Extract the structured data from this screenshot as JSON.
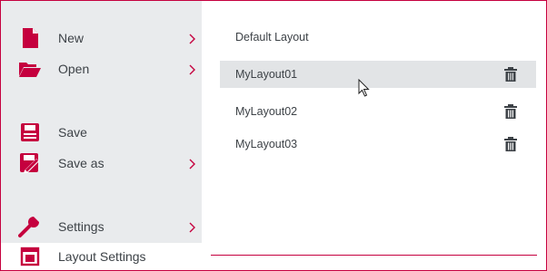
{
  "sidebar": {
    "items": [
      {
        "label": "New",
        "icon": "new-file-icon"
      },
      {
        "label": "Open",
        "icon": "folder-open-icon"
      },
      {
        "label": "Save",
        "icon": "save-icon"
      },
      {
        "label": "Save as",
        "icon": "save-as-icon"
      },
      {
        "label": "Settings",
        "icon": "wrench-icon"
      },
      {
        "label": "Layout Settings",
        "icon": "layout-icon"
      }
    ]
  },
  "panel": {
    "default_layout_label": "Default Layout",
    "layouts": [
      {
        "name": "MyLayout01",
        "delete_icon": "trash-icon"
      },
      {
        "name": "MyLayout02",
        "delete_icon": "trash-icon"
      },
      {
        "name": "MyLayout03",
        "delete_icon": "trash-icon"
      }
    ]
  },
  "colors": {
    "accent": "#c5003e",
    "sidebar_bg": "#e9ebed",
    "selected_row_bg": "#e2e4e6",
    "text": "#3d4247"
  }
}
